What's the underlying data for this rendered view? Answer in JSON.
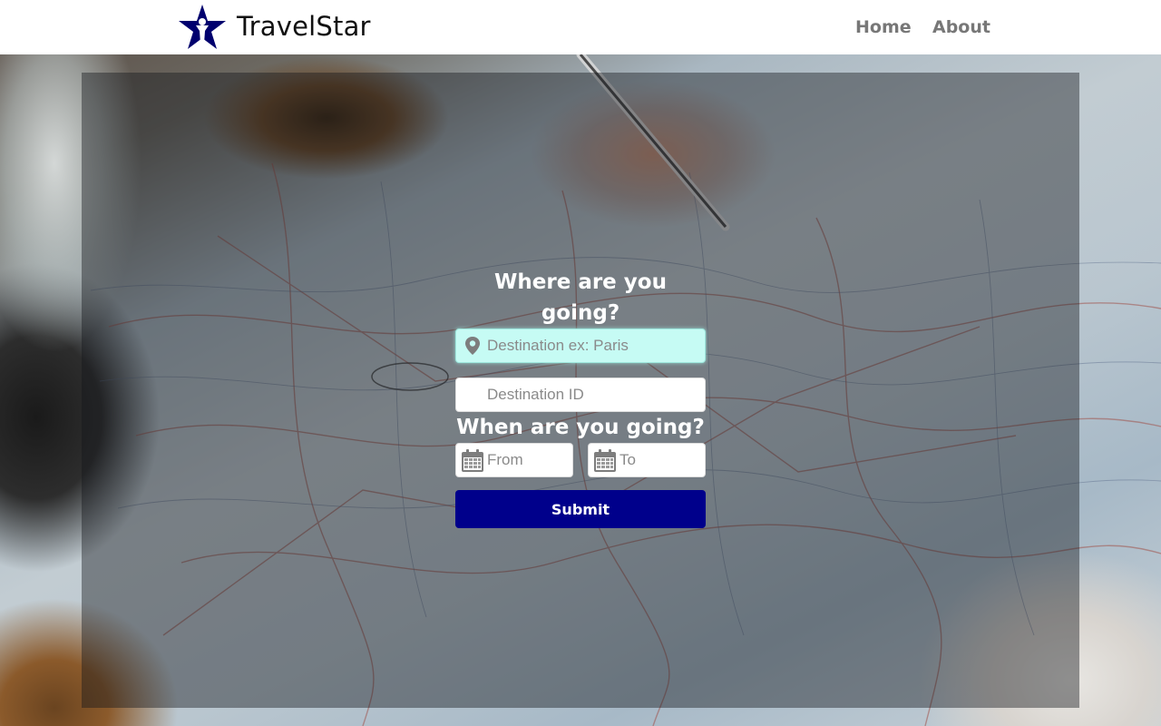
{
  "header": {
    "brand": "TravelStar",
    "nav": {
      "home": "Home",
      "about": "About"
    }
  },
  "search": {
    "destination_title": "Where are you going?",
    "destination_placeholder": "Destination ex: Paris",
    "destination_id_placeholder": "Destination ID",
    "dates_title": "When are you going?",
    "from_placeholder": "From",
    "to_placeholder": "To",
    "submit_label": "Submit"
  },
  "colors": {
    "brand_navy": "#00008b",
    "focus_field": "#c6fbf4"
  },
  "icons": {
    "logo": "star-person-icon",
    "destination": "map-pin-icon",
    "date": "calendar-icon"
  }
}
